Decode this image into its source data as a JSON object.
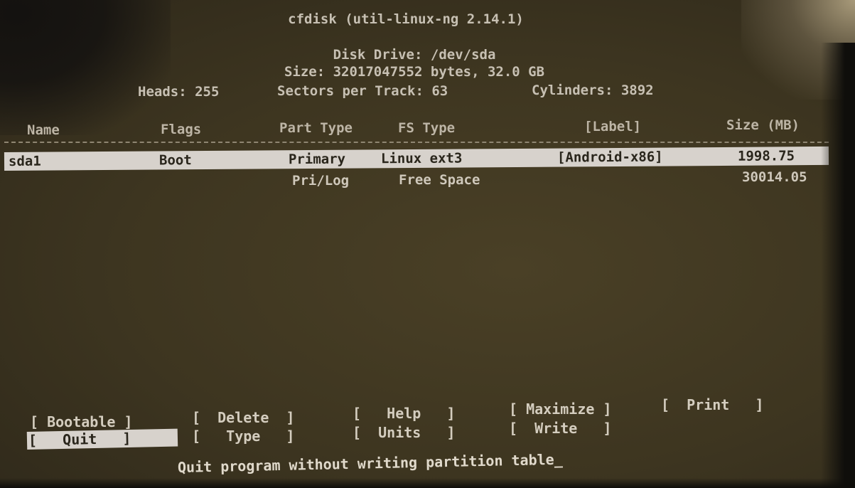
{
  "header": {
    "title": "cfdisk (util-linux-ng 2.14.1)",
    "disk_drive": "Disk Drive: /dev/sda",
    "size": "Size: 32017047552 bytes, 32.0 GB",
    "heads": "Heads: 255",
    "sectors": "Sectors per Track: 63",
    "cylinders": "Cylinders: 3892"
  },
  "columns": {
    "name": "Name",
    "flags": "Flags",
    "part_type": "Part Type",
    "fs_type": "FS Type",
    "label": "[Label]",
    "size": "Size (MB)"
  },
  "rows": [
    {
      "name": "sda1",
      "flags": "Boot",
      "part_type": "Primary",
      "fs_type": "Linux ext3",
      "label": "[Android-x86]",
      "size": "1998.75"
    },
    {
      "name": "",
      "flags": "",
      "part_type": "Pri/Log",
      "fs_type": "Free Space",
      "label": "",
      "size": "30014.05"
    }
  ],
  "menu": {
    "bootable": "[ Bootable ]",
    "delete": "[  Delete  ]",
    "help": "[   Help   ]",
    "maximize": "[ Maximize ]",
    "print": "[  Print   ]",
    "quit": "[   Quit   ]",
    "type": "[   Type   ]",
    "units": "[  Units   ]",
    "write": "[  Write   ]"
  },
  "status": "Quit program without writing partition table_",
  "colors": {
    "background": "#3d3520",
    "text": "#ccc3b4",
    "highlight": "#d7d2cc"
  }
}
